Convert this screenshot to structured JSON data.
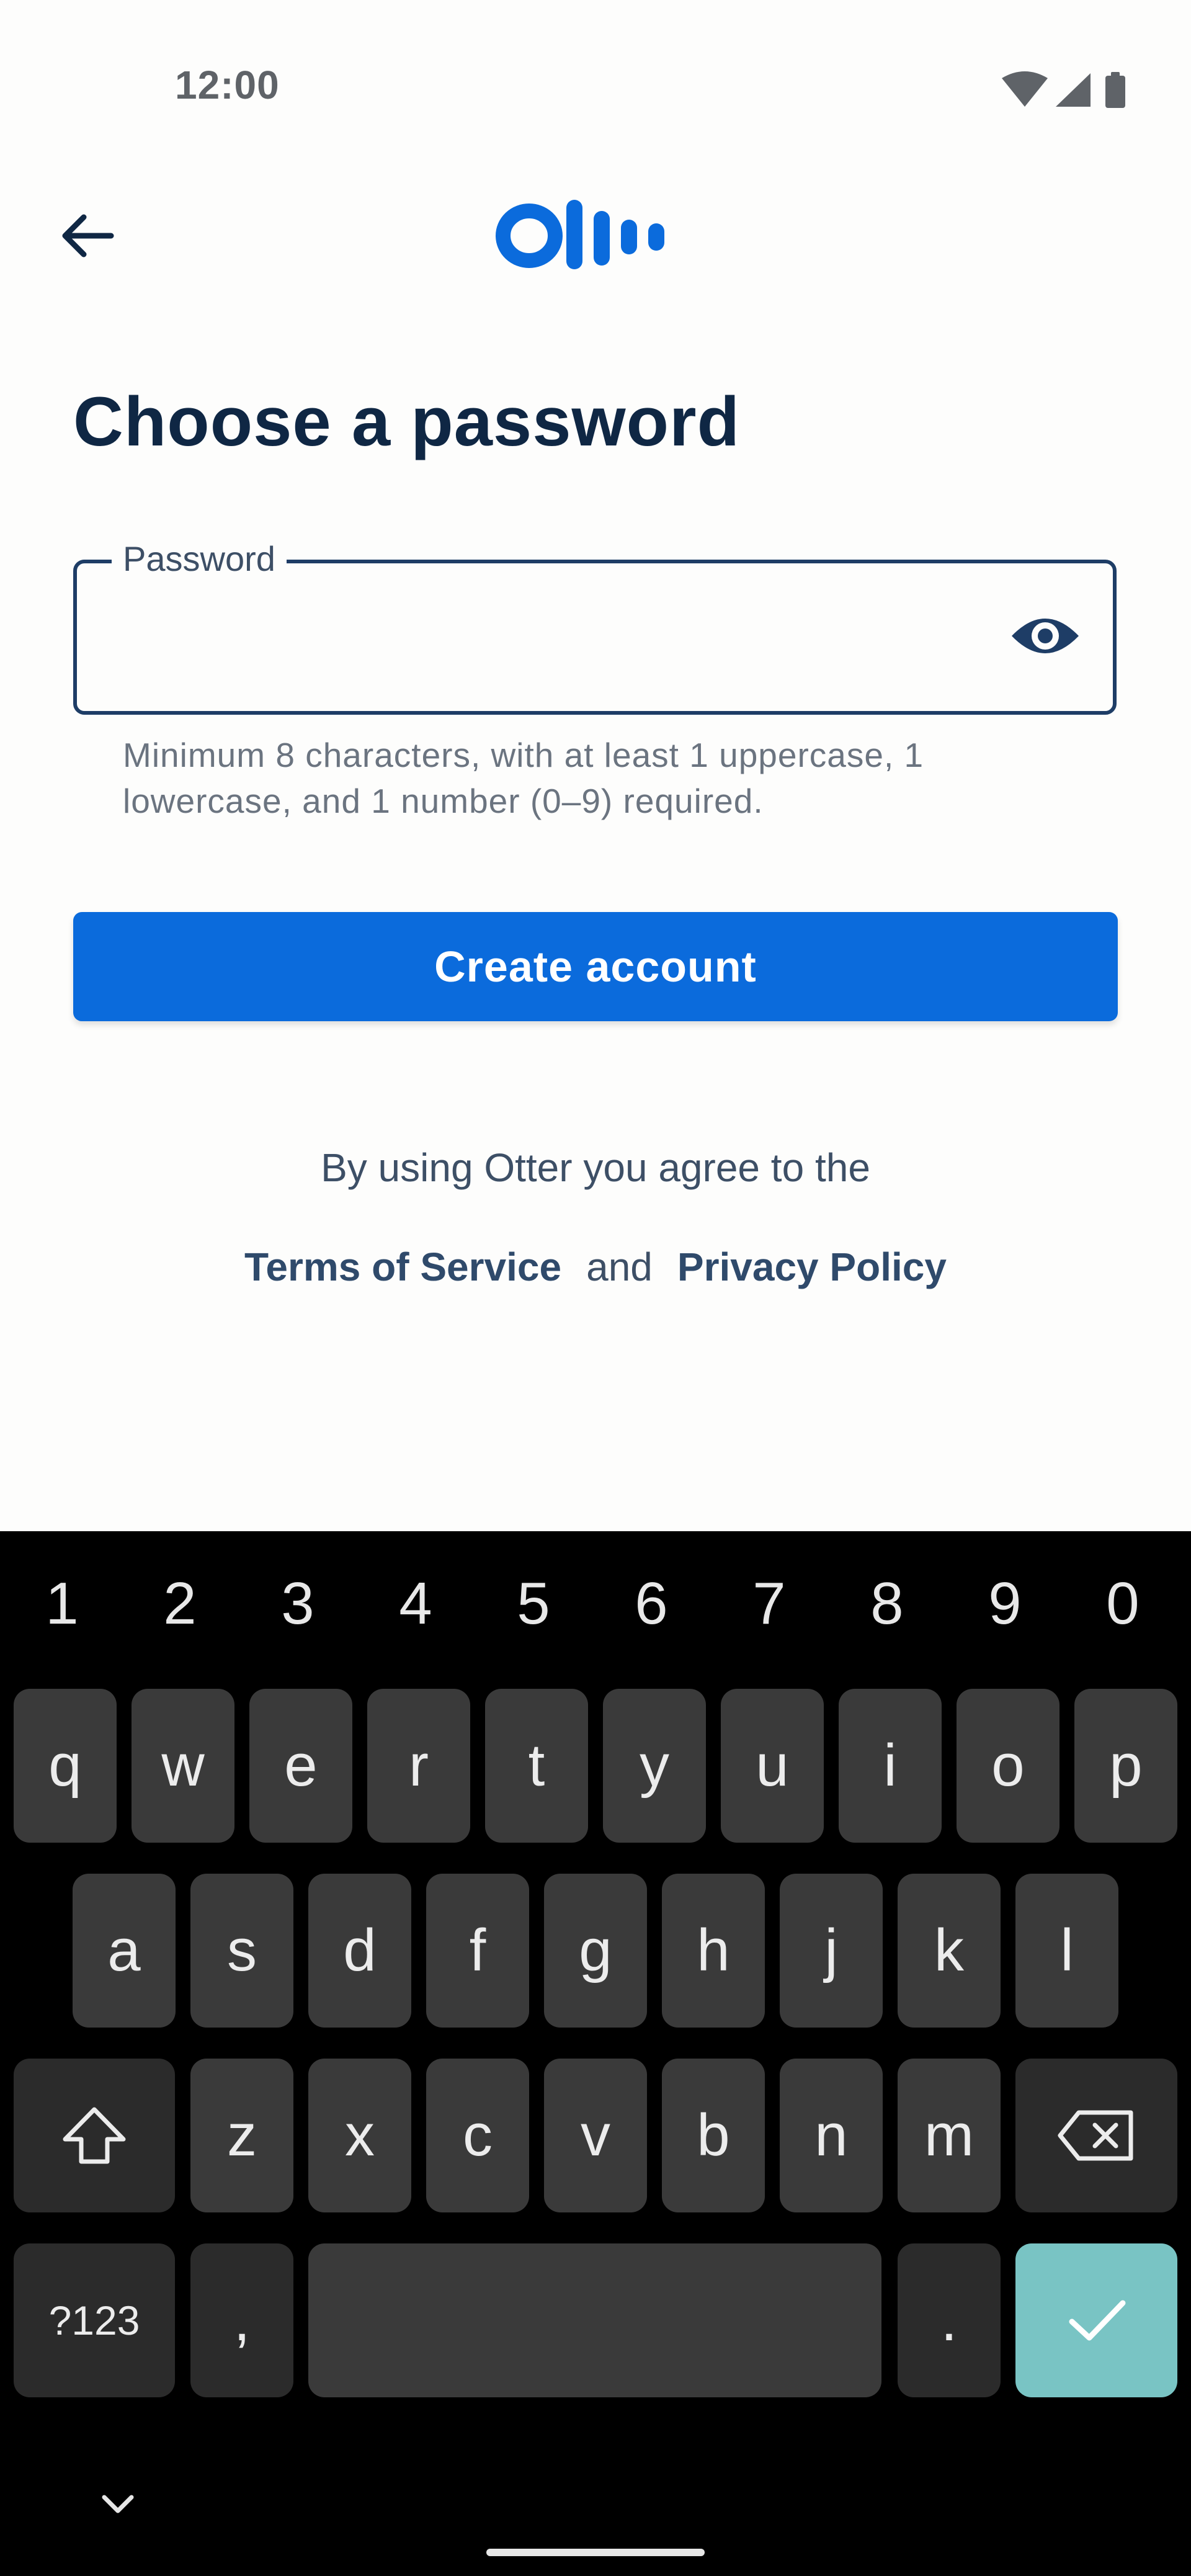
{
  "status_bar": {
    "time": "12:00"
  },
  "app_bar": {
    "logo_name": "otter-logo",
    "back_icon": "back-arrow-icon"
  },
  "page": {
    "title": "Choose a password"
  },
  "password_field": {
    "label": "Password",
    "value": "",
    "helper": "Minimum 8 characters, with at least 1 uppercase, 1 lowercase, and 1 number (0–9) required.",
    "toggle_icon": "eye-icon"
  },
  "create_button": {
    "label": "Create account"
  },
  "legal": {
    "agree_text": "By using Otter you agree to the",
    "terms": "Terms of Service",
    "and": "and",
    "privacy": "Privacy Policy"
  },
  "keyboard": {
    "numbers": [
      "1",
      "2",
      "3",
      "4",
      "5",
      "6",
      "7",
      "8",
      "9",
      "0"
    ],
    "row1": [
      "q",
      "w",
      "e",
      "r",
      "t",
      "y",
      "u",
      "i",
      "o",
      "p"
    ],
    "row2": [
      "a",
      "s",
      "d",
      "f",
      "g",
      "h",
      "j",
      "k",
      "l"
    ],
    "row3": [
      "z",
      "x",
      "c",
      "v",
      "b",
      "n",
      "m"
    ],
    "symbols_key": "?123",
    "comma": ",",
    "period": ".",
    "accent_color": "#79c4c4"
  },
  "colors": {
    "primary": "#0b6bdc",
    "title": "#0f2744"
  }
}
